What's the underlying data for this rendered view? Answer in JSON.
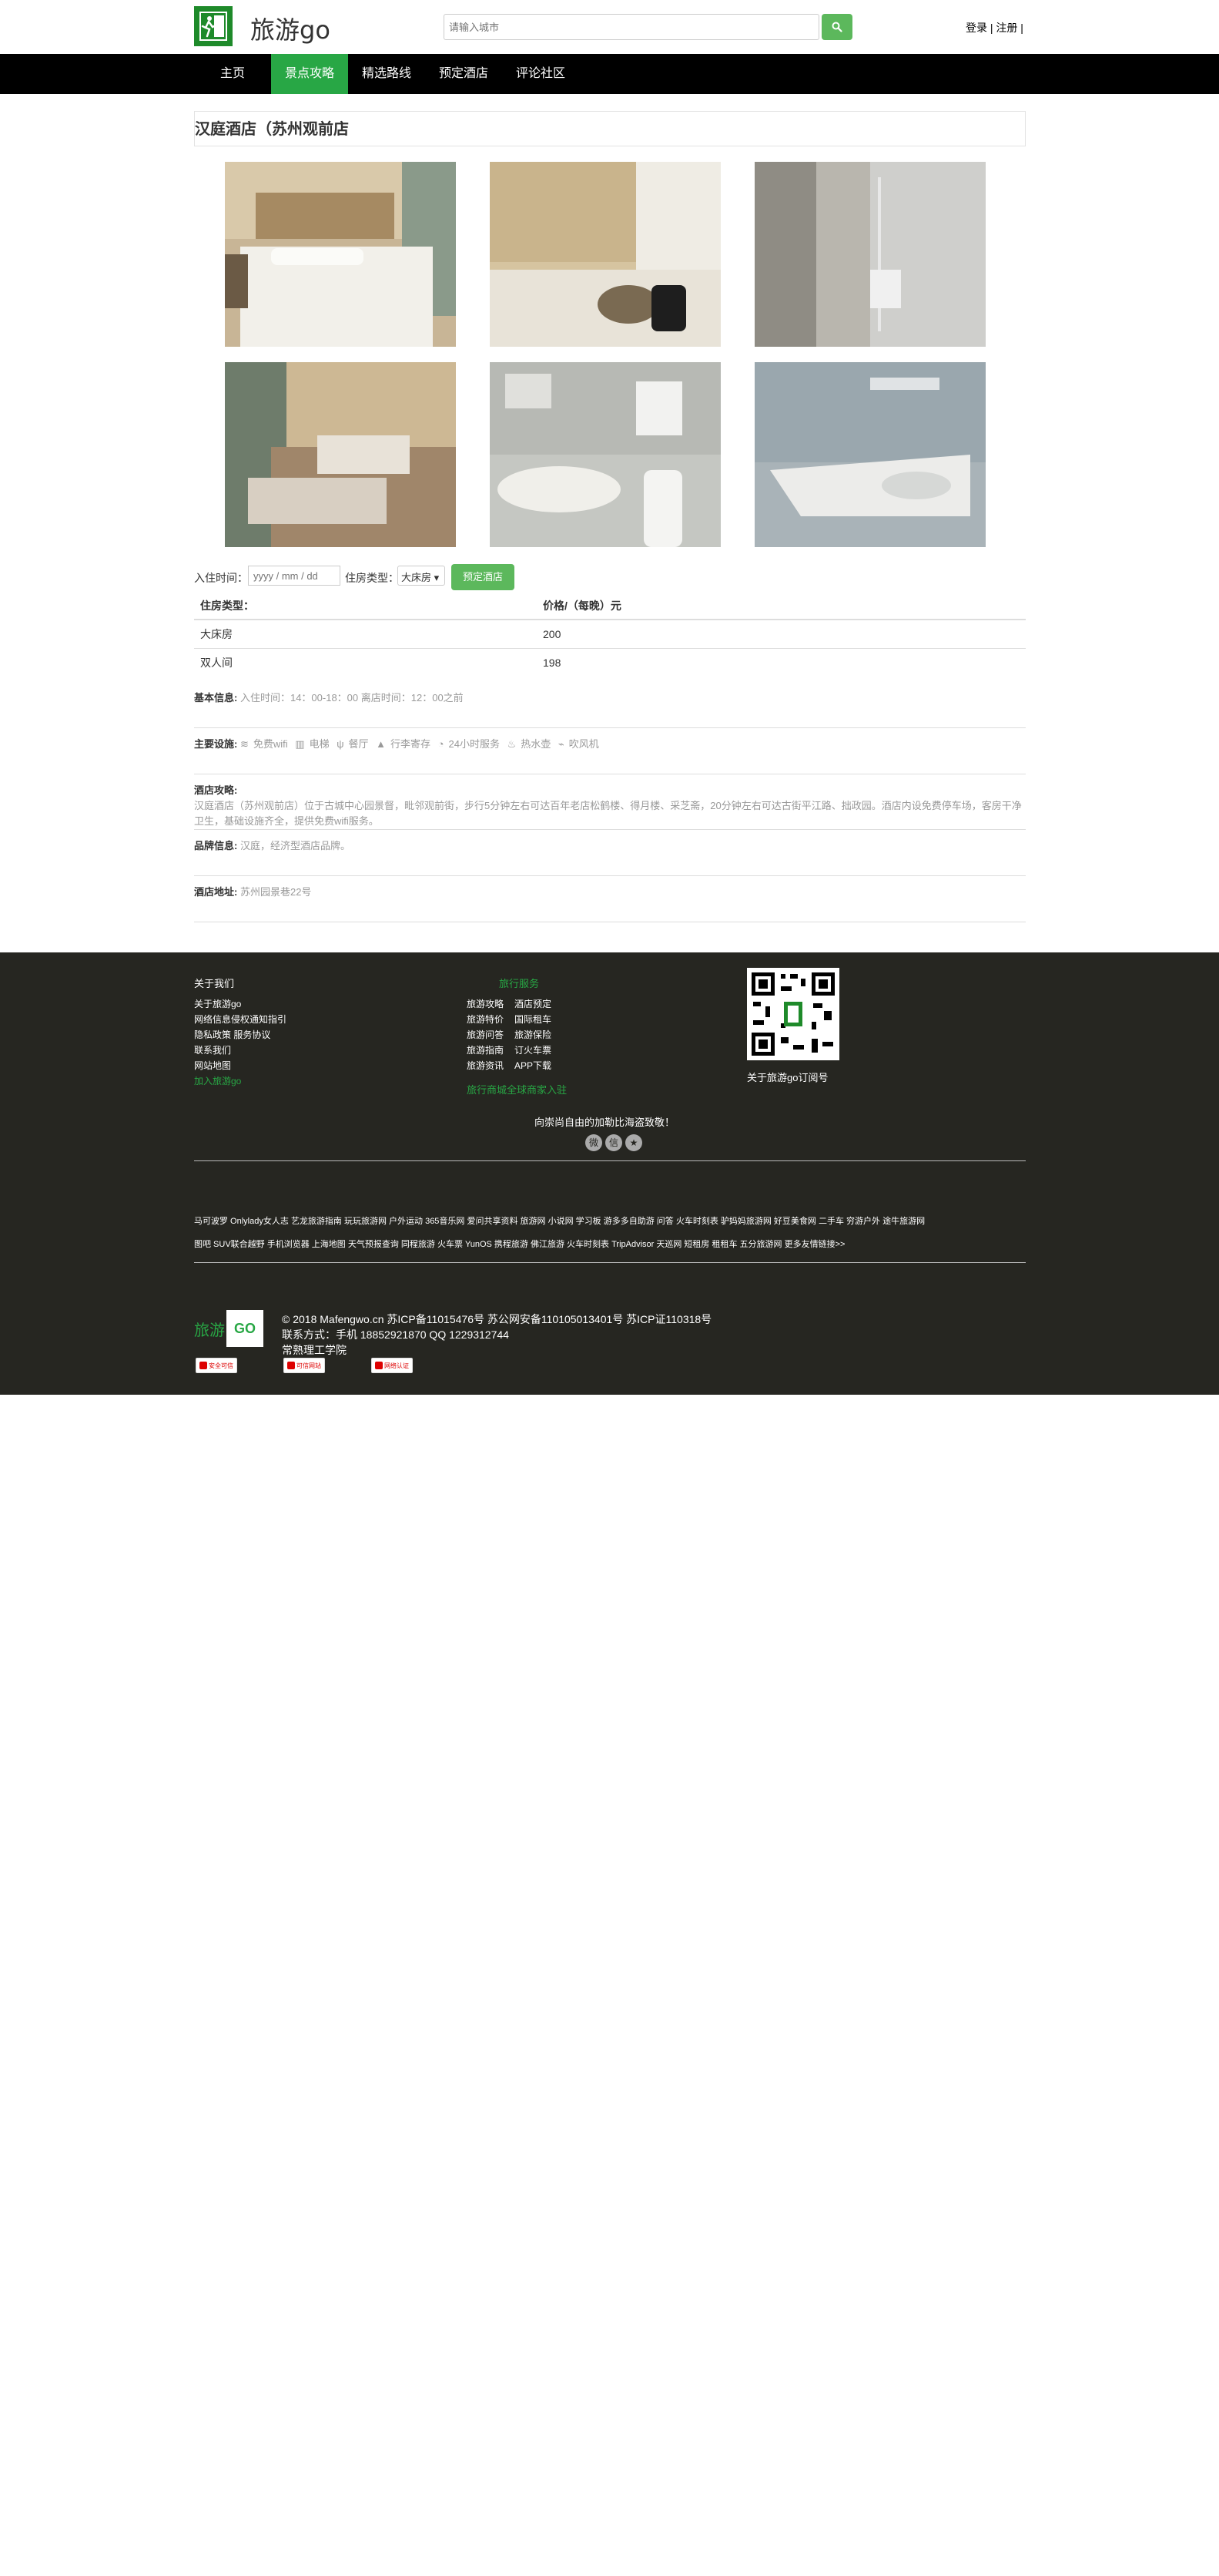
{
  "header": {
    "brand": "旅游go",
    "search_placeholder": "请输入城市",
    "login": "登录",
    "register": "注册"
  },
  "nav": {
    "items": [
      {
        "label": "主页",
        "active": false
      },
      {
        "label": "景点攻略",
        "active": true
      },
      {
        "label": "精选路线",
        "active": false
      },
      {
        "label": "预定酒店",
        "active": false
      },
      {
        "label": "评论社区",
        "active": false
      }
    ]
  },
  "hotel": {
    "name": "汉庭酒店（苏州观前店",
    "photos": [
      "room-bed-1",
      "room-luggage",
      "shower-glass",
      "twin-room",
      "bathroom-sink",
      "shower-basin"
    ]
  },
  "booking": {
    "checkin_label": "入住时间：",
    "date_placeholder": "yyyy / mm / dd",
    "room_type_label": "住房类型：",
    "room_selected": "大床房",
    "book_button": "预定酒店"
  },
  "price_table": {
    "headers": [
      "住房类型：",
      "价格/（每晚）元"
    ],
    "rows": [
      [
        "大床房",
        "200"
      ],
      [
        "双人间",
        "198"
      ]
    ]
  },
  "info": {
    "basic_label": "基本信息:",
    "basic_value": "入住时间：14：00-18：00 离店时间：12：00之前",
    "facilities_label": "主要设施:",
    "facilities": [
      {
        "icon": "wifi-icon",
        "glyph": "≋",
        "label": "免费wifi"
      },
      {
        "icon": "elevator-icon",
        "glyph": "▥",
        "label": "电梯"
      },
      {
        "icon": "restaurant-icon",
        "glyph": "ψ",
        "label": "餐厅"
      },
      {
        "icon": "luggage-icon",
        "glyph": "▲",
        "label": "行李寄存"
      },
      {
        "icon": "clock-icon",
        "glyph": "◔",
        "label": "24小时服务"
      },
      {
        "icon": "water-icon",
        "glyph": "♨",
        "label": "热水壶"
      },
      {
        "icon": "hairdryer-icon",
        "glyph": "⌁",
        "label": "吹风机"
      }
    ],
    "guide_label": "酒店攻略:",
    "guide_text": "汉庭酒店（苏州观前店）位于古城中心园景督，毗邻观前街，步行5分钟左右可达百年老店松鹤楼、得月楼、采芝斋，20分钟左右可达古街平江路、拙政园。酒店内设免费停车场，客房干净卫生，基础设施齐全，提供免费wifi服务。",
    "brand_label": "品牌信息:",
    "brand_value": "汉庭，经济型酒店品牌。",
    "address_label": "酒店地址:",
    "address_value": "苏州园景巷22号"
  },
  "footer": {
    "about_title": "关于我们",
    "about_links": [
      "关于旅游go",
      "网络信息侵权通知指引",
      "隐私政策  服务协议",
      "联系我们",
      "网站地图"
    ],
    "join_link": "加入旅游go",
    "service_title": "旅行服务",
    "service_links": [
      [
        "旅游攻略",
        "酒店预定"
      ],
      [
        "旅游特价",
        "国际租车"
      ],
      [
        "旅游问答",
        "旅游保险"
      ],
      [
        "旅游指南",
        "订火车票"
      ],
      [
        "旅游资讯",
        "APP下载"
      ]
    ],
    "merchant_link": "旅行商城全球商家入驻",
    "qr_caption": "关于旅游go订阅号",
    "slogan": "向崇尚自由的加勒比海盗致敬！",
    "social_icons": [
      {
        "name": "weibo-icon",
        "glyph": "微"
      },
      {
        "name": "wechat-icon",
        "glyph": "信"
      },
      {
        "name": "star-icon",
        "glyph": "★"
      }
    ],
    "friend_links_1": "马可波罗 Onlylady女人志 艺龙旅游指南 玩玩旅游网 户外运动 365音乐网 爱问共享资料 旅游网 小说网 学习板 游多多自助游 问答 火车时刻表 驴妈妈旅游网 好豆美食网 二手车 穷游户外 途牛旅游网",
    "friend_links_2": "图吧 SUV联合越野 手机浏览器 上海地图 天气预报查询 同程旅游 火车票 YunOS 携程旅游 佛江旅游 火车时刻表 TripAdvisor 天巡网 短租房 租租车 五分旅游网 更多友情链接>>",
    "footer_logo_text": "旅游",
    "footer_logo_go": "GO",
    "copyright": "© 2018 Mafengwo.cn 苏ICP备11015476号 苏公网安备110105013401号 苏ICP证110318号",
    "contact": "联系方式：手机 18852921870 QQ 1229312744",
    "school": "常熟理工学院",
    "badges": [
      "安全可信",
      "可信网站",
      "网络认证"
    ]
  }
}
